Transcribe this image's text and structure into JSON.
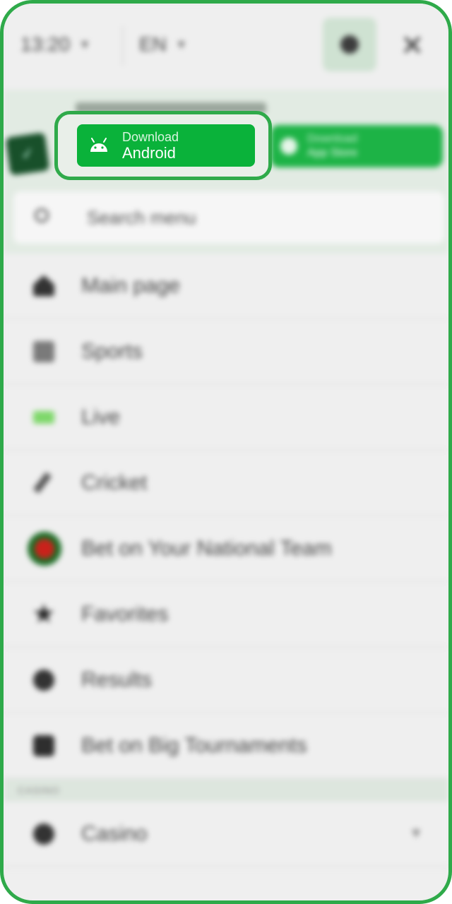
{
  "topbar": {
    "time": "13:20",
    "language": "EN",
    "settings_icon": "gear-icon",
    "close_icon": "close-icon"
  },
  "banner": {
    "android_button": {
      "line1": "Download",
      "line2": "Android",
      "icon": "android-icon"
    },
    "ios_button": {
      "line1": "Download",
      "line2": "App Store",
      "icon": "apple-icon"
    }
  },
  "search": {
    "placeholder": "Search menu"
  },
  "menu": {
    "items": [
      {
        "label": "Main page",
        "icon": "home-icon"
      },
      {
        "label": "Sports",
        "icon": "sports-icon"
      },
      {
        "label": "Live",
        "icon": "live-icon"
      },
      {
        "label": "Cricket",
        "icon": "cricket-icon"
      },
      {
        "label": "Bet on Your National Team",
        "icon": "flag-icon"
      },
      {
        "label": "Favorites",
        "icon": "star-icon"
      },
      {
        "label": "Results",
        "icon": "results-icon"
      },
      {
        "label": "Bet on Big Tournaments",
        "icon": "tournament-icon"
      }
    ],
    "section": "CASINO",
    "casino_item": {
      "label": "Casino",
      "icon": "casino-icon"
    }
  },
  "colors": {
    "accent": "#0ab23a",
    "frame": "#2faa4a",
    "background": "#efefef"
  }
}
